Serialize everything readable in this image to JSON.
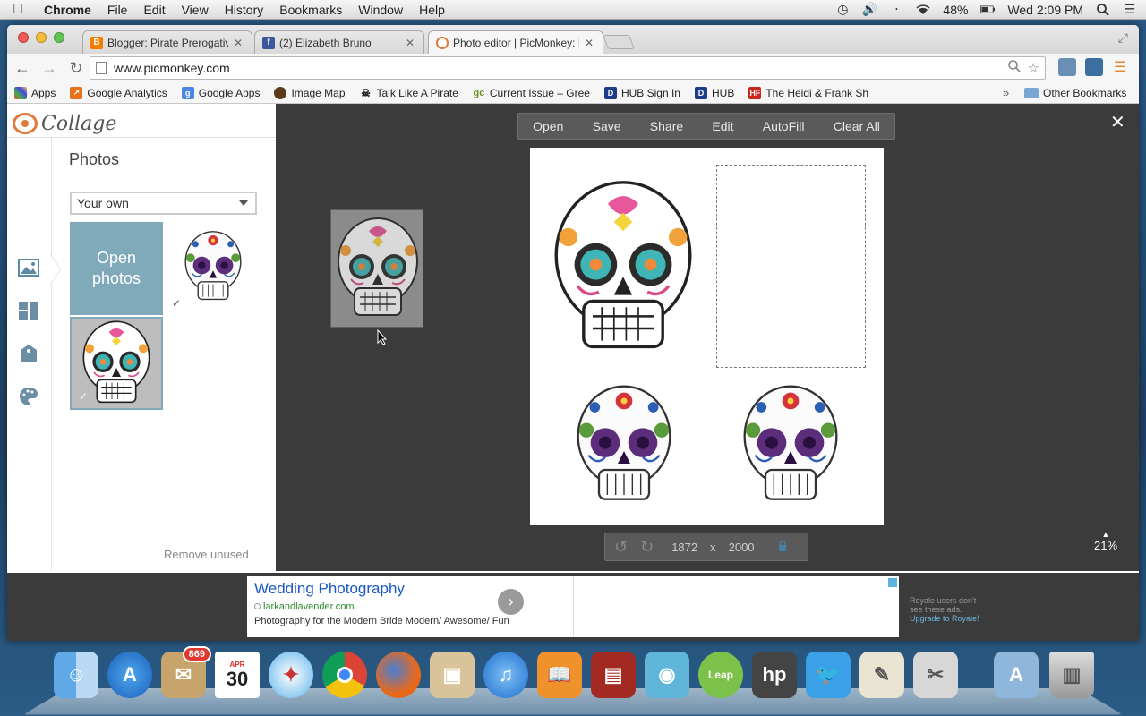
{
  "menubar": {
    "app": "Chrome",
    "items": [
      "File",
      "Edit",
      "View",
      "History",
      "Bookmarks",
      "Window",
      "Help"
    ],
    "battery": "48%",
    "clock": "Wed 2:09 PM"
  },
  "tabs": [
    {
      "title": "Blogger: Pirate Prerogative",
      "icon": "blogger-icon"
    },
    {
      "title": "(2) Elizabeth Bruno",
      "icon": "facebook-icon"
    },
    {
      "title": "Photo editor | PicMonkey: P",
      "icon": "picmonkey-icon"
    }
  ],
  "address": "www.picmonkey.com",
  "bookmarks": {
    "items": [
      "Apps",
      "Google Analytics",
      "Google Apps",
      "Image Map",
      "Talk Like A Pirate",
      "Current Issue – Gree",
      "HUB Sign In",
      "HUB",
      "The Heidi & Frank Sh"
    ],
    "more": "»",
    "other": "Other Bookmarks"
  },
  "panel": {
    "logo": "Collage",
    "title": "Photos",
    "source": "Your own",
    "open_photos": "Open photos",
    "remove_unused": "Remove unused"
  },
  "collage_toolbar": [
    "Open",
    "Save",
    "Share",
    "Edit",
    "AutoFill",
    "Clear All"
  ],
  "canvas_size": {
    "width": "1872",
    "x": "x",
    "height": "2000"
  },
  "zoom": "21%",
  "ad": {
    "title": "Wedding Photography",
    "url": "larkandlavender.com",
    "desc": "Photography for the Modern Bride Modern/ Awesome/ Fun",
    "royale_1": "Royale users don't",
    "royale_2": "see these ads.",
    "royale_link": "Upgrade to Royale!"
  },
  "dock": {
    "mail_badge": "869",
    "calendar_month": "APR",
    "calendar_day": "30"
  },
  "colors": {
    "accent": "#80aab9",
    "logo": "#e07a3a",
    "ad_link": "#1a56c6"
  }
}
